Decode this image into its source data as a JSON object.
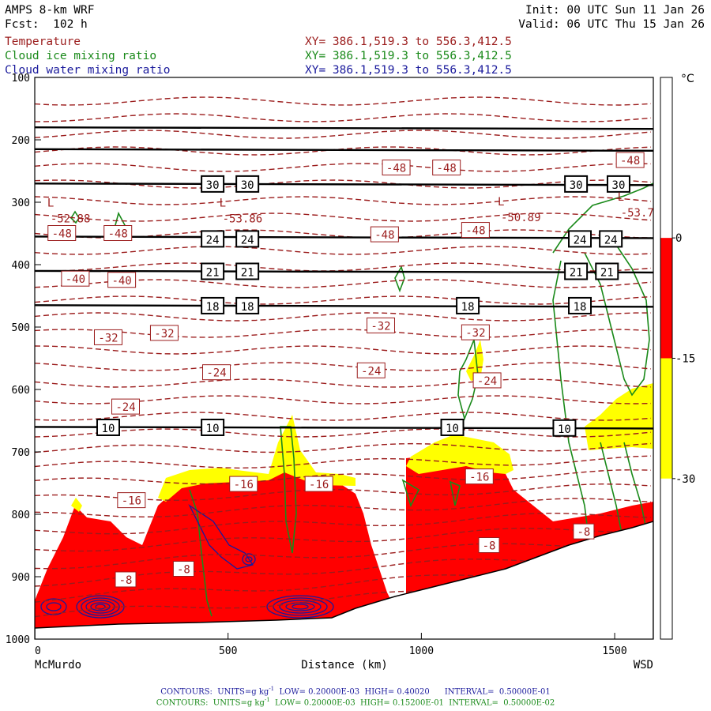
{
  "header": {
    "model": "AMPS 8-km WRF",
    "forecast": "Fcst:  102 h",
    "init": "Init: 00 UTC Sun 11 Jan 26",
    "valid": "Valid: 06 UTC Thu 15 Jan 26"
  },
  "fields": [
    {
      "name": "Temperature",
      "xy": "XY= 386.1,519.3 to 556.3,412.5",
      "color": "#9b1c1c"
    },
    {
      "name": "Cloud ice mixing ratio",
      "xy": "XY= 386.1,519.3 to 556.3,412.5",
      "color": "#1a8a1a"
    },
    {
      "name": "Cloud water mixing ratio",
      "xy": "XY= 386.1,519.3 to 556.3,412.5",
      "color": "#1a1a9c"
    }
  ],
  "footer": {
    "blue_prefix": "CONTOURS:  UNITS=g kg",
    "blue_rest": "  LOW= 0.20000E-03  HIGH= 0.40020      INTERVAL=  0.50000E-01",
    "green_prefix": "CONTOURS:  UNITS=g kg",
    "green_rest": "  LOW= 0.20000E-03  HIGH= 0.15200E-01  INTERVAL=  0.50000E-02",
    "units_exp": "-1"
  },
  "chart_data": {
    "type": "cross-section",
    "xlabel": "Distance (km)",
    "xlim": [
      0,
      1600
    ],
    "xticks": [
      0,
      500,
      1000,
      1500
    ],
    "x_endpoints": {
      "left": "McMurdo",
      "right": "WSD"
    },
    "ylim": [
      1000,
      100
    ],
    "yticks": [
      100,
      200,
      300,
      400,
      500,
      600,
      700,
      800,
      900,
      1000
    ],
    "colorbar": {
      "unit": "°C",
      "ticks": [
        0,
        -15,
        -30
      ],
      "bands": [
        {
          "range": [
            0,
            20
          ],
          "color": "#ffffff"
        },
        {
          "range": [
            -15,
            0
          ],
          "color": "#ff0000"
        },
        {
          "range": [
            -30,
            -15
          ],
          "color": "#ffff00"
        },
        {
          "range": [
            -50,
            -30
          ],
          "color": "#ffffff"
        }
      ]
    },
    "theta_lines": [
      {
        "p": 180
      },
      {
        "p": 215
      },
      {
        "p": 270
      },
      {
        "p": 355
      },
      {
        "p": 410
      },
      {
        "p": 465
      },
      {
        "p": 660
      }
    ],
    "theta_labels": [
      {
        "x": 460,
        "p": 272,
        "label": "30"
      },
      {
        "x": 550,
        "p": 272,
        "label": "30"
      },
      {
        "x": 1400,
        "p": 272,
        "label": "30"
      },
      {
        "x": 1510,
        "p": 272,
        "label": "30"
      },
      {
        "x": 460,
        "p": 360,
        "label": "24"
      },
      {
        "x": 550,
        "p": 360,
        "label": "24"
      },
      {
        "x": 1410,
        "p": 360,
        "label": "24"
      },
      {
        "x": 1490,
        "p": 360,
        "label": "24"
      },
      {
        "x": 460,
        "p": 412,
        "label": "21"
      },
      {
        "x": 550,
        "p": 412,
        "label": "21"
      },
      {
        "x": 1400,
        "p": 412,
        "label": "21"
      },
      {
        "x": 1480,
        "p": 412,
        "label": "21"
      },
      {
        "x": 460,
        "p": 467,
        "label": "18"
      },
      {
        "x": 550,
        "p": 467,
        "label": "18"
      },
      {
        "x": 1120,
        "p": 467,
        "label": "18"
      },
      {
        "x": 1410,
        "p": 467,
        "label": "18"
      },
      {
        "x": 190,
        "p": 662,
        "label": "10"
      },
      {
        "x": 460,
        "p": 662,
        "label": "10"
      },
      {
        "x": 1080,
        "p": 662,
        "label": "10"
      },
      {
        "x": 1370,
        "p": 663,
        "label": "10"
      }
    ],
    "temperature_labels": [
      {
        "x": 935,
        "p": 245,
        "label": "-48"
      },
      {
        "x": 1065,
        "p": 245,
        "label": "-48"
      },
      {
        "x": 1540,
        "p": 233,
        "label": "-48"
      },
      {
        "x": 70,
        "p": 350,
        "label": "-48"
      },
      {
        "x": 215,
        "p": 350,
        "label": "-48"
      },
      {
        "x": 905,
        "p": 352,
        "label": "-48"
      },
      {
        "x": 1140,
        "p": 345,
        "label": "-48"
      },
      {
        "x": 105,
        "p": 423,
        "label": "-40"
      },
      {
        "x": 225,
        "p": 425,
        "label": "-40"
      },
      {
        "x": 190,
        "p": 517,
        "label": "-32"
      },
      {
        "x": 335,
        "p": 510,
        "label": "-32"
      },
      {
        "x": 895,
        "p": 498,
        "label": "-32"
      },
      {
        "x": 1140,
        "p": 509,
        "label": "-32"
      },
      {
        "x": 470,
        "p": 573,
        "label": "-24"
      },
      {
        "x": 870,
        "p": 570,
        "label": "-24"
      },
      {
        "x": 235,
        "p": 628,
        "label": "-24"
      },
      {
        "x": 1170,
        "p": 586,
        "label": "-24"
      },
      {
        "x": 540,
        "p": 752,
        "label": "-16"
      },
      {
        "x": 735,
        "p": 752,
        "label": "-16"
      },
      {
        "x": 250,
        "p": 778,
        "label": "-16"
      },
      {
        "x": 1150,
        "p": 740,
        "label": "-16"
      },
      {
        "x": 1175,
        "p": 850,
        "label": "-8"
      },
      {
        "x": 385,
        "p": 888,
        "label": "-8"
      },
      {
        "x": 1420,
        "p": 828,
        "label": "-8"
      },
      {
        "x": 235,
        "p": 905,
        "label": "-8"
      }
    ],
    "minima": [
      {
        "x": 110,
        "p": 330,
        "label": "-52.88"
      },
      {
        "x": 555,
        "p": 330,
        "label": "-53.86"
      },
      {
        "x": 1275,
        "p": 328,
        "label": "-50.89"
      },
      {
        "x": 1585,
        "p": 320,
        "label": "-53.7"
      }
    ],
    "min_marker": "L"
  }
}
